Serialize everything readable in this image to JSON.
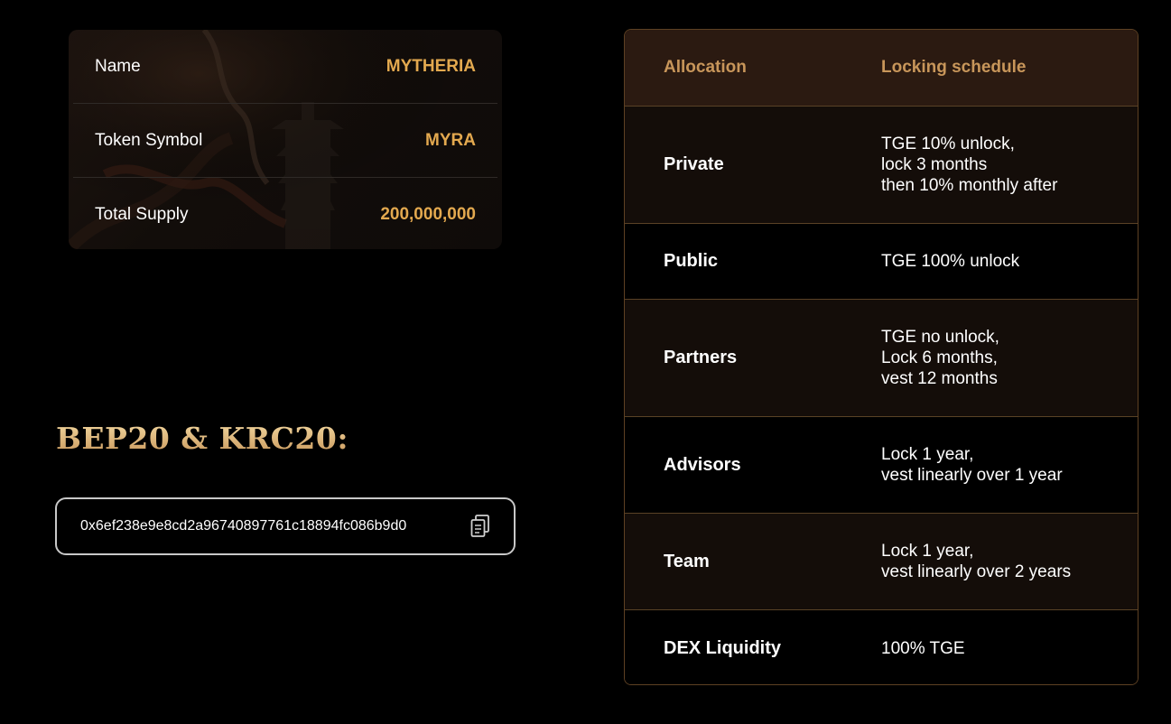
{
  "token": {
    "rows": [
      {
        "label": "Name",
        "value": "MYTHERIA"
      },
      {
        "label": "Token Symbol",
        "value": "MYRA"
      },
      {
        "label": "Total Supply",
        "value": "200,000,000"
      }
    ]
  },
  "contract": {
    "title": "BEP20 & KRC20:",
    "address": "0x6ef238e9e8cd2a96740897761c18894fc086b9d0",
    "copy_icon": "copy-icon"
  },
  "allocation": {
    "headers": {
      "allocation": "Allocation",
      "schedule": "Locking schedule"
    },
    "rows": [
      {
        "name": "Private",
        "schedule": [
          "TGE 10% unlock,",
          "lock 3 months",
          "then 10% monthly after"
        ]
      },
      {
        "name": "Public",
        "schedule": [
          "TGE 100% unlock"
        ]
      },
      {
        "name": "Partners",
        "schedule": [
          "TGE no unlock,",
          "Lock 6 months,",
          "vest 12 months"
        ]
      },
      {
        "name": "Advisors",
        "schedule": [
          "Lock 1 year,",
          "vest linearly over 1 year"
        ]
      },
      {
        "name": "Team",
        "schedule": [
          "Lock 1 year,",
          "vest linearly over 2 years"
        ]
      },
      {
        "name": "DEX Liquidity",
        "schedule": [
          "100% TGE"
        ]
      }
    ]
  },
  "colors": {
    "accent_gold": "#e3a94f",
    "header_gold": "#c8965a",
    "table_border": "#5e4123"
  }
}
